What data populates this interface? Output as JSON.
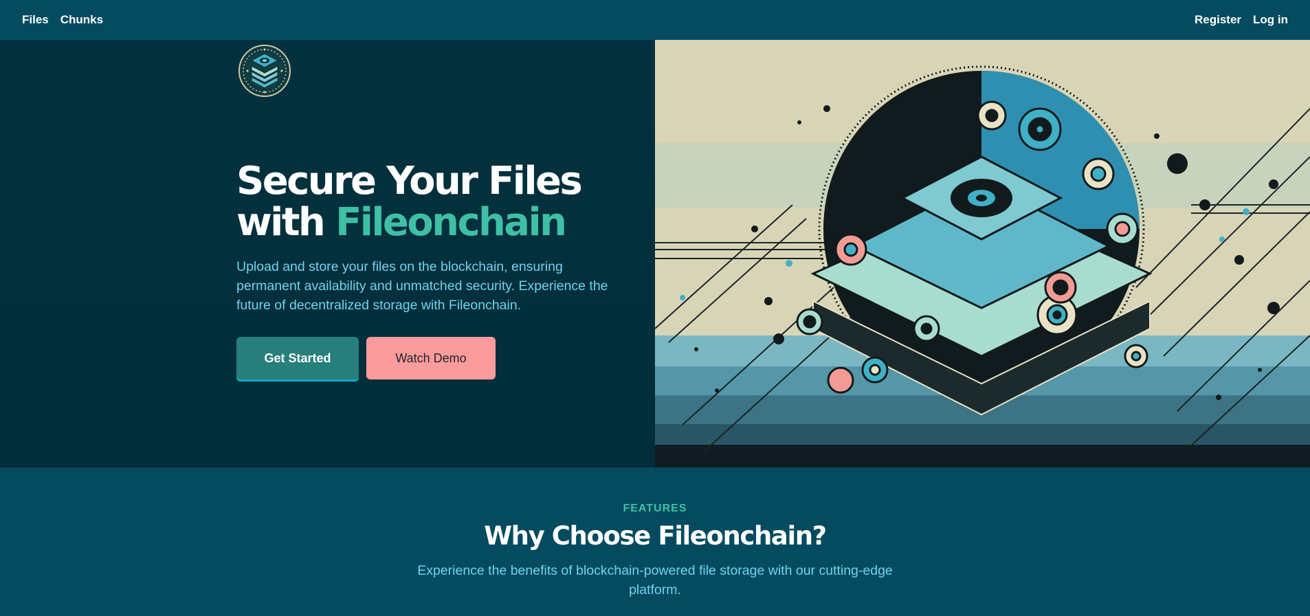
{
  "nav": {
    "left": [
      {
        "label": "Files"
      },
      {
        "label": "Chunks"
      }
    ],
    "right": [
      {
        "label": "Register"
      },
      {
        "label": "Log in"
      }
    ]
  },
  "hero": {
    "logo_icon": "storage-stack-icon",
    "headline_line1": "Secure Your Files",
    "headline_with": "with ",
    "headline_brand": "Fileonchain",
    "description": "Upload and store your files on the blockchain, ensuring permanent availability and unmatched security. Experience the future of decentralized storage with Fileonchain.",
    "primary_button": "Get Started",
    "secondary_button": "Watch Demo",
    "illustration": "decentralized-storage-illustration"
  },
  "features": {
    "eyebrow": "FEATURES",
    "title": "Why Choose Fileonchain?",
    "subtitle": "Experience the benefits of blockchain-powered file storage with our cutting-edge platform."
  },
  "colors": {
    "nav_bg": "#044b5f",
    "hero_bg": "#03313f",
    "accent": "#3fc0a5",
    "text_light": "#6fd3ef",
    "primary_button": "#267f7a",
    "secondary_button": "#fb9b9b"
  }
}
